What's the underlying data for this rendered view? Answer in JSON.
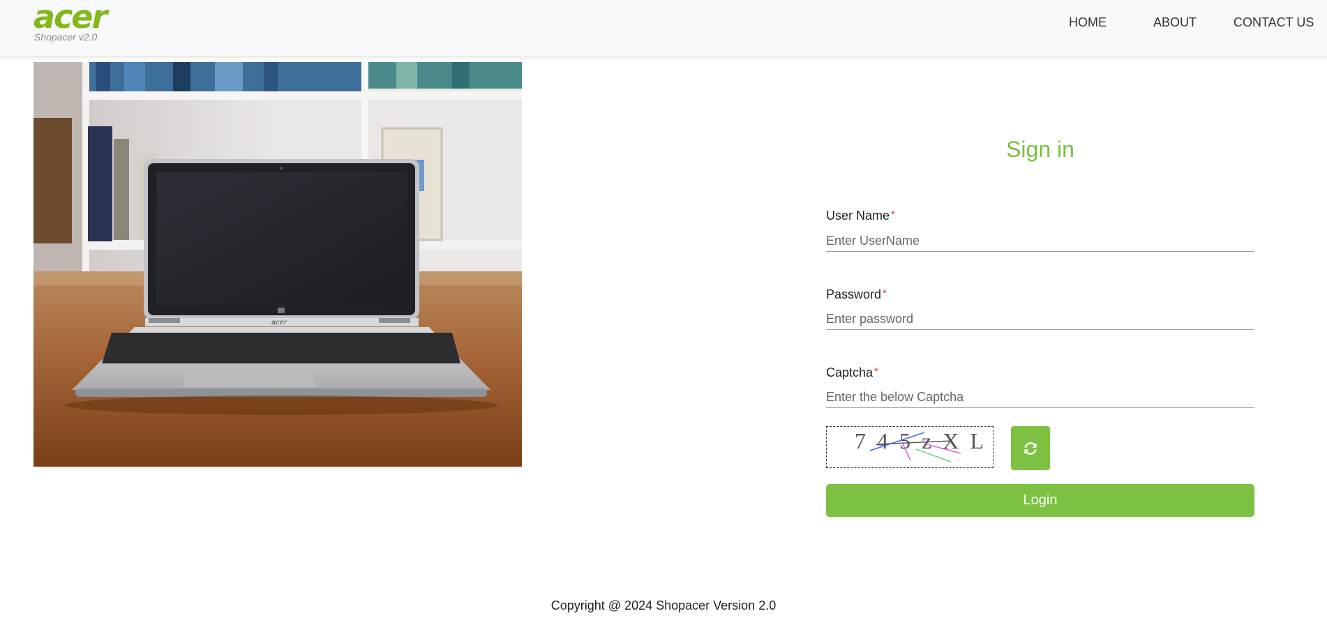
{
  "header": {
    "logo": "acer",
    "tagline": "Shopacer v2.0",
    "nav": [
      "HOME",
      "ABOUT",
      "CONTACT US"
    ]
  },
  "hero": {
    "image": "laptop-on-desk-photo",
    "keyboard_brand": "acer"
  },
  "form": {
    "title": "Sign in",
    "username": {
      "label": "User Name",
      "required": "*",
      "placeholder": "Enter UserName"
    },
    "password": {
      "label": "Password",
      "required": "*",
      "placeholder": "Enter password"
    },
    "captcha": {
      "label": "Captcha",
      "required": "*",
      "placeholder": "Enter the below Captcha",
      "code": "7 4 5 z X L"
    },
    "refresh_icon": "refresh-icon",
    "login_label": "Login"
  },
  "footer": {
    "copyright": "Copyright @ 2024 Shopacer Version 2.0"
  },
  "colors": {
    "brand": "#83b81a",
    "accent": "#7cc142",
    "required": "#e53935"
  }
}
